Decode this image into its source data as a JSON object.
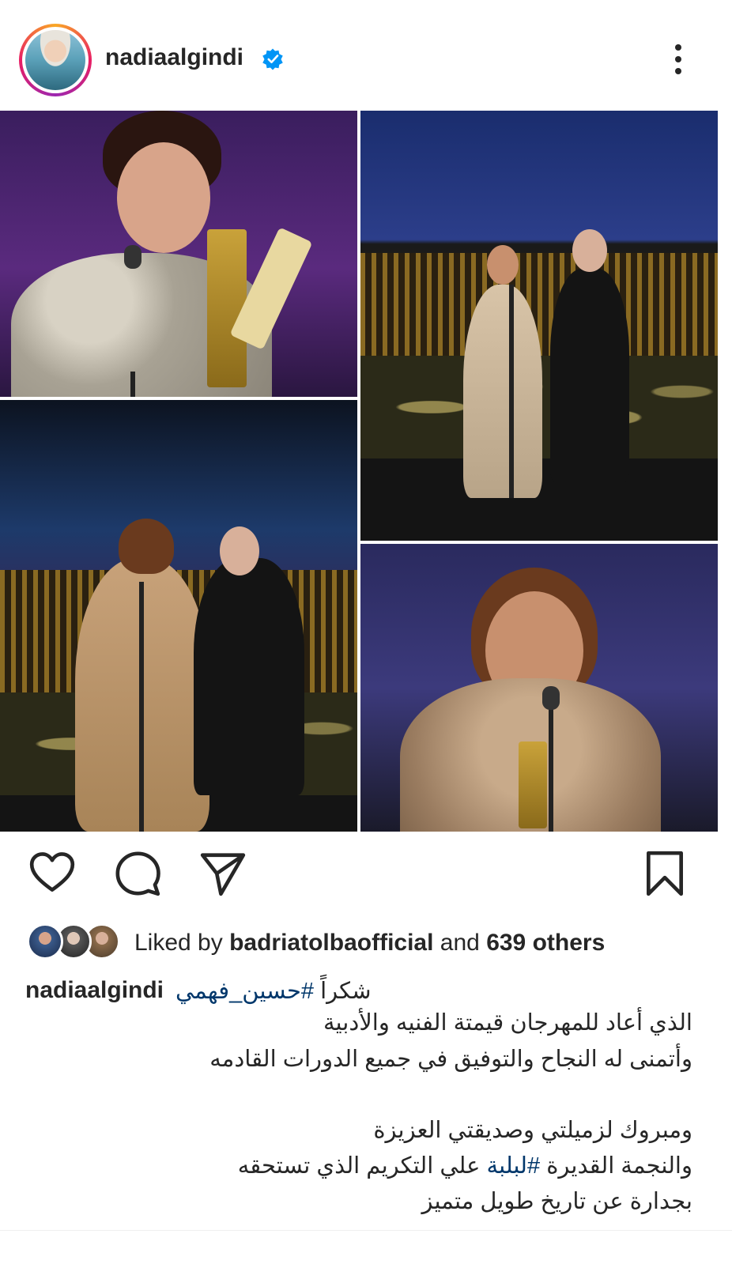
{
  "header": {
    "username": "nadiaalgindi",
    "verified_icon": "verified-badge-icon",
    "more_icon": "more-vertical-icon"
  },
  "collage": {
    "photos": [
      {
        "description_icon": "photo"
      },
      {
        "description_icon": "photo"
      },
      {
        "description_icon": "photo"
      },
      {
        "description_icon": "photo"
      }
    ]
  },
  "actions": {
    "like_icon": "heart-icon",
    "comment_icon": "comment-icon",
    "share_icon": "send-icon",
    "save_icon": "bookmark-icon"
  },
  "likes": {
    "prefix": "Liked by ",
    "user": "badriatolbaofficial",
    "middle": " and ",
    "others": "639 others"
  },
  "caption": {
    "username": "nadiaalgindi",
    "first_word": "شكراً ",
    "first_hashtag": "#حسين_فهمي",
    "lines": [
      "الذي أعاد للمهرجان قيمتة الفنيه والأدبية",
      "وأتمنى له النجاح والتوفيق في جميع الدورات القادمه",
      "ومبروك لزميلتي وصديقتي العزيزة",
      "بجدارة عن تاريخ طويل متميز"
    ],
    "line5_before": "والنجمة القديرة ",
    "line5_hashtag": "#لبلبة",
    "line5_after": " علي التكريم الذي تستحقه"
  },
  "colors": {
    "text": "#262626",
    "hashtag": "#00376b",
    "verified": "#0095f6"
  }
}
